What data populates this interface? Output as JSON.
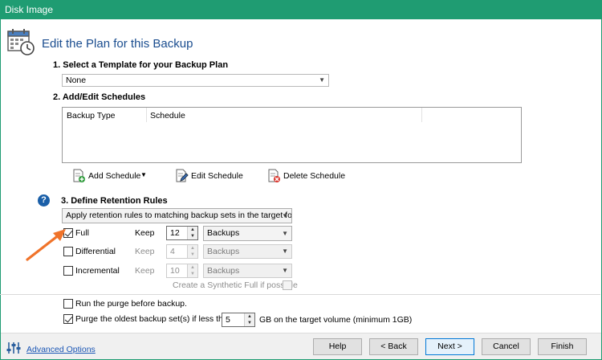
{
  "window": {
    "title": "Disk Image"
  },
  "header": {
    "title": "Edit the Plan for this Backup"
  },
  "template": {
    "label": "1. Select a Template for your Backup Plan",
    "selected": "None"
  },
  "schedules": {
    "label": "2. Add/Edit Schedules",
    "columns": [
      "Backup Type",
      "Schedule"
    ],
    "add_label": "Add Schedule",
    "edit_label": "Edit Schedule",
    "delete_label": "Delete Schedule"
  },
  "retention": {
    "label": "3. Define Retention Rules",
    "rule_option": "Apply retention rules to matching backup sets in the target folder",
    "keep_label": "Keep",
    "rows": [
      {
        "label": "Full",
        "checked": true,
        "enabled": true,
        "count": "12",
        "unit": "Backups"
      },
      {
        "label": "Differential",
        "checked": false,
        "enabled": false,
        "count": "4",
        "unit": "Backups"
      },
      {
        "label": "Incremental",
        "checked": false,
        "enabled": false,
        "count": "10",
        "unit": "Backups"
      }
    ],
    "synthetic_label": "Create a Synthetic Full if possible"
  },
  "purge": {
    "before_label": "Run the purge before backup.",
    "oldest_label": "Purge the oldest backup set(s) if less than",
    "oldest_value": "5",
    "oldest_suffix": "GB on the target volume (minimum 1GB)"
  },
  "footer": {
    "advanced_label": "Advanced Options",
    "help": "Help",
    "back": "< Back",
    "next": "Next >",
    "cancel": "Cancel",
    "finish": "Finish"
  },
  "colors": {
    "titlebar": "#1f9c72",
    "heading": "#1a4d8f",
    "link": "#1a56b5",
    "annotation_arrow": "#f0732a"
  }
}
